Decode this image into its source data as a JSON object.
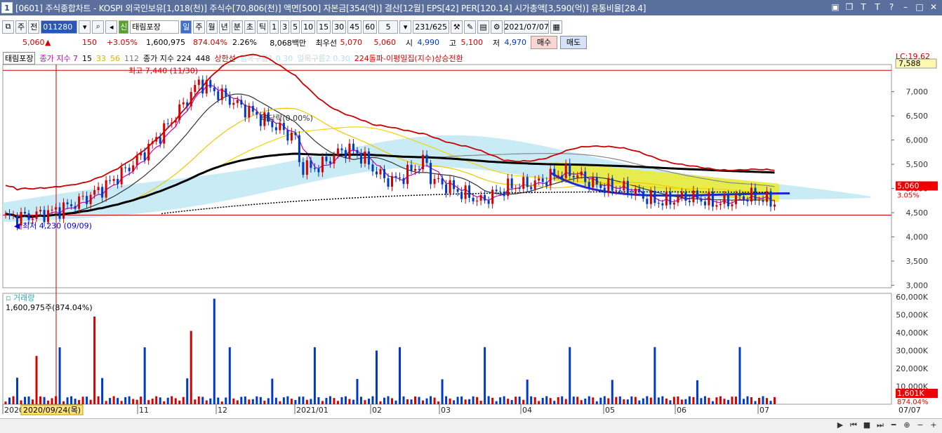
{
  "window": {
    "number": "1",
    "title": "[0601] 주식종합차트 - KOSPI 외국인보유[1,018(천)] 주식수[70,806(천)] 액면[500] 자본금[354(억)] 결산[12월] EPS[42] PER[120.14] 시가총액[3,590(억)] 유통비율[28.4]"
  },
  "toolbar": {
    "market": "주",
    "range": "전",
    "code": "011280",
    "credit": "신",
    "stock_name": "태림포장",
    "periods": [
      "일",
      "주",
      "월",
      "년",
      "분",
      "초",
      "틱"
    ],
    "active_period": "일",
    "intervals": [
      "1",
      "3",
      "5",
      "10",
      "15",
      "30",
      "45",
      "60"
    ],
    "count": "5",
    "pages": "231/625",
    "date": "2021/07/07"
  },
  "quote": {
    "price": "5,060",
    "arrow": "▲",
    "change": "150",
    "change_pct": "+3.05%",
    "volume": "1,600,975",
    "volume_pct": "874.04%",
    "turnover": "2.26%",
    "amount": "8,068백만",
    "best_ask_label": "최우선",
    "best_ask": "5,070",
    "best_bid": "5,060",
    "open_label": "시",
    "open": "4,990",
    "high_label": "고",
    "high": "5,100",
    "low_label": "저",
    "low": "4,970",
    "buy": "매수",
    "sell": "매도"
  },
  "legend": {
    "stock": "태림포장",
    "ma_label": "종가 지수 7",
    "ma15": "15",
    "ma33": "33",
    "ma56": "56",
    "ma112": "112",
    "long_label": "종가 지수 224",
    "ma448": "448",
    "upper": "상한선",
    "cloud1": "일목구름1 0.30",
    "cloud2": "일목구름2 0.30",
    "signal": "224돌파-이평밀집(지수)상승전환",
    "lc": "LC:19.62"
  },
  "chart_data": {
    "type": "candlestick",
    "price_axis": {
      "ticks": [
        7000,
        6500,
        6000,
        5500,
        5000,
        4500,
        4000,
        3500,
        3000
      ],
      "ylim": [
        2950,
        7560
      ]
    },
    "current_price": "5,060",
    "current_pct": "3.05%",
    "max_label": "7,588",
    "annotations": {
      "high": "최고 7,440 (11/30)",
      "low": "최저 4,230 (09/09)",
      "dividend": "배당락(0.00%)"
    },
    "months": [
      "2020",
      "11",
      "12",
      "2021/01",
      "02",
      "03",
      "04",
      "05",
      "06",
      "07"
    ],
    "cursor_date": "2020/09/24(목)",
    "right_date": "07/07",
    "volume_panel": {
      "title": "거래량",
      "summary": "1,600,975주(874.04%)",
      "ticks": [
        "60,000K",
        "50,000K",
        "40,000K",
        "30,000K",
        "20,000K",
        "10,000K"
      ],
      "current": "1,601K",
      "current_pct": "874.04%"
    },
    "colors": {
      "up": "#d50000",
      "down": "#0039c6",
      "ma_black": "#000000",
      "upper": "#c80000",
      "cloud": "#bfe8f5"
    }
  }
}
